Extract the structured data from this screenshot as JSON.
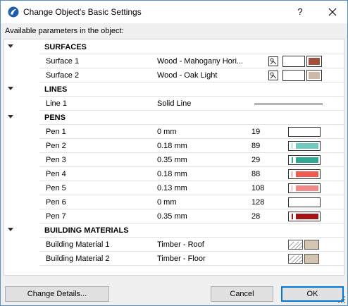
{
  "window": {
    "title": "Change Object's Basic Settings",
    "help_label": "?"
  },
  "available_label": "Available parameters in the object:",
  "groups": {
    "surfaces": "SURFACES",
    "lines": "LINES",
    "pens": "PENS",
    "building_materials": "BUILDING MATERIALS"
  },
  "surfaces": [
    {
      "name": "Surface 1",
      "value": "Wood - Mahogany Hori...",
      "color": "#a0523d"
    },
    {
      "name": "Surface 2",
      "value": "Wood - Oak Light",
      "color": "#c9b9a6"
    }
  ],
  "lines": [
    {
      "name": "Line 1",
      "value": "Solid Line"
    }
  ],
  "pens": [
    {
      "name": "Pen 1",
      "value": "0 mm",
      "number": "19",
      "color": ""
    },
    {
      "name": "Pen 2",
      "value": "0.18 mm",
      "number": "89",
      "color": "#72c9bf"
    },
    {
      "name": "Pen 3",
      "value": "0.35 mm",
      "number": "29",
      "color": "#2eaa94"
    },
    {
      "name": "Pen 4",
      "value": "0.18 mm",
      "number": "88",
      "color": "#f05a50"
    },
    {
      "name": "Pen 5",
      "value": "0.13 mm",
      "number": "108",
      "color": "#f08a86"
    },
    {
      "name": "Pen 6",
      "value": "0 mm",
      "number": "128",
      "color": ""
    },
    {
      "name": "Pen 7",
      "value": "0.35 mm",
      "number": "28",
      "color": "#a31512"
    }
  ],
  "building_materials": [
    {
      "name": "Building Material 1",
      "value": "Timber - Roof",
      "color": "#d4c5b0"
    },
    {
      "name": "Building Material 2",
      "value": "Timber - Floor",
      "color": "#d4c5b0"
    }
  ],
  "buttons": {
    "change_details": "Change Details...",
    "cancel": "Cancel",
    "ok": "OK"
  }
}
